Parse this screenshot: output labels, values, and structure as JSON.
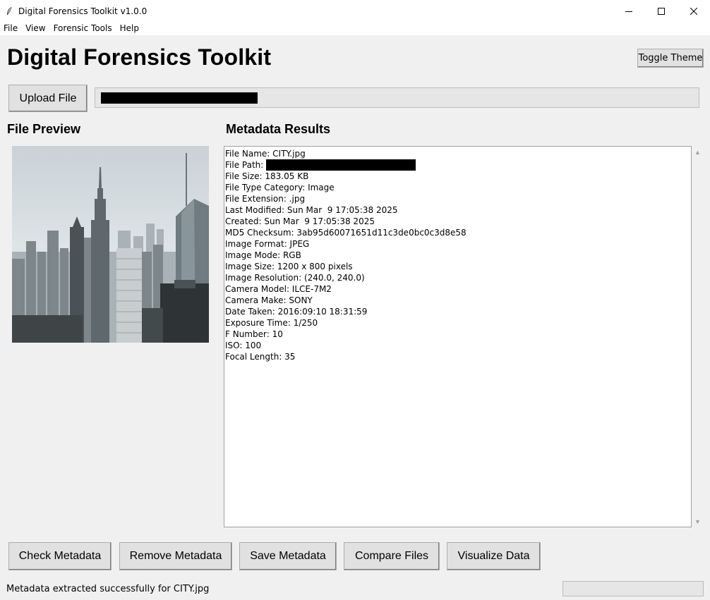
{
  "window": {
    "title": "Digital Forensics Toolkit v1.0.0",
    "controls": [
      "minimize-icon",
      "maximize-icon",
      "close-icon"
    ]
  },
  "menu": [
    "File",
    "View",
    "Forensic Tools",
    "Help"
  ],
  "header": {
    "title": "Digital Forensics Toolkit",
    "toggle_theme": "Toggle Theme"
  },
  "upload": {
    "button": "Upload File",
    "path_redacted": true
  },
  "preview": {
    "label": "File Preview",
    "image": "city-skyline-photo"
  },
  "metadata": {
    "label": "Metadata Results",
    "lines": [
      {
        "key": "File Name",
        "value": "CITY.jpg"
      },
      {
        "key": "File Path",
        "value": "",
        "redacted": true
      },
      {
        "key": "File Size",
        "value": "183.05 KB"
      },
      {
        "key": "File Type Category",
        "value": "Image"
      },
      {
        "key": "File Extension",
        "value": ".jpg"
      },
      {
        "key": "Last Modified",
        "value": "Sun Mar  9 17:05:38 2025"
      },
      {
        "key": "Created",
        "value": "Sun Mar  9 17:05:38 2025"
      },
      {
        "key": "MD5 Checksum",
        "value": "3ab95d60071651d11c3de0bc0c3d8e58"
      },
      {
        "key": "Image Format",
        "value": "JPEG"
      },
      {
        "key": "Image Mode",
        "value": "RGB"
      },
      {
        "key": "Image Size",
        "value": "1200 x 800 pixels"
      },
      {
        "key": "Image Resolution",
        "value": "(240.0, 240.0)"
      },
      {
        "key": "Camera Model",
        "value": "ILCE-7M2"
      },
      {
        "key": "Camera Make",
        "value": "SONY"
      },
      {
        "key": "Date Taken",
        "value": "2016:09:10 18:31:59"
      },
      {
        "key": "Exposure Time",
        "value": "1/250"
      },
      {
        "key": "F Number",
        "value": "10"
      },
      {
        "key": "ISO",
        "value": "100"
      },
      {
        "key": "Focal Length",
        "value": "35"
      }
    ]
  },
  "actions": {
    "check": "Check Metadata",
    "remove": "Remove Metadata",
    "save": "Save Metadata",
    "compare": "Compare Files",
    "visualize": "Visualize Data"
  },
  "status": {
    "text": "Metadata extracted successfully for CITY.jpg",
    "progress": 0
  },
  "colors": {
    "window_bg": "#f0f0f0",
    "button_bg": "#e1e1e1",
    "field_bg": "#ffffff"
  }
}
